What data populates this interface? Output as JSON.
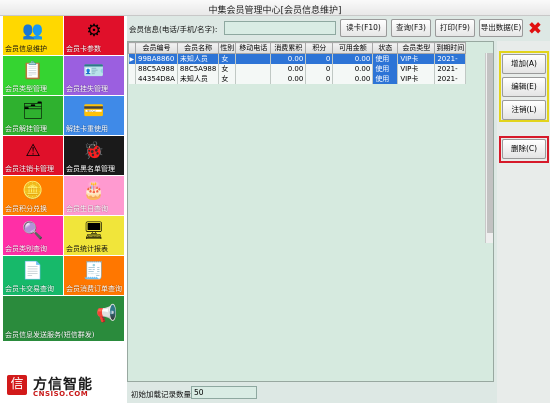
{
  "window": {
    "title": "中集会员管理中心[会员信息维护]"
  },
  "tiles": [
    {
      "label": "会员信息维护",
      "color": "#ffd800",
      "icon": "customer-card-icon",
      "glyph": "👥"
    },
    {
      "label": "会员卡参数",
      "color": "#e0102a",
      "icon": "card-settings-icon",
      "glyph": "⚙"
    },
    {
      "label": "会员类型管理",
      "color": "#35d431",
      "icon": "member-type-icon",
      "glyph": "📋"
    },
    {
      "label": "会员挂失管理",
      "color": "#9b5fe0",
      "icon": "report-loss-icon",
      "glyph": "🪪"
    },
    {
      "label": "会员解挂管理",
      "color": "#2fb12f",
      "icon": "unfreeze-icon",
      "glyph": "🗂"
    },
    {
      "label": "解挂卡重使用",
      "color": "#3f8ae8",
      "icon": "card-reuse-icon",
      "glyph": "💳"
    },
    {
      "label": "会员注销卡管理",
      "color": "#e0102a",
      "icon": "cancel-card-icon",
      "glyph": "⚠"
    },
    {
      "label": "会员黑名单管理",
      "color": "#1a1a1a",
      "icon": "blacklist-bug-icon",
      "glyph": "🐞"
    },
    {
      "label": "会员积分兑换",
      "color": "#ff7f00",
      "icon": "points-exchange-icon",
      "glyph": "🪙"
    },
    {
      "label": "会员生日查询",
      "color": "#ff9ad0",
      "icon": "birthday-icon",
      "glyph": "🎂"
    },
    {
      "label": "会员类别查询",
      "color": "#ff2fa6",
      "icon": "category-search-icon",
      "glyph": "🔍"
    },
    {
      "label": "会员统计报表",
      "color": "#f1e53a",
      "icon": "statistics-report-icon",
      "glyph": "🖥"
    },
    {
      "label": "会员卡交易查询",
      "color": "#17b96a",
      "icon": "card-transaction-icon",
      "glyph": "📄"
    },
    {
      "label": "会员消费订单查询",
      "color": "#ff7700",
      "icon": "consume-order-icon",
      "glyph": "🧾"
    },
    {
      "label": "会员信息发送服务(短信群发)",
      "color": "#2a8b3c",
      "icon": "sms-send-icon",
      "glyph": "📢"
    }
  ],
  "logo": {
    "brand": "方信智能",
    "site": "CNSISO.COM",
    "mark": "信"
  },
  "search": {
    "label": "会员信息(电话/手机/名字):",
    "value": "",
    "read_card_button": "读卡(F10)",
    "query_button": "查询(F3)",
    "print_button": "打印(F9)",
    "export_button": "导出数据(E)"
  },
  "table": {
    "columns": [
      "会员编号",
      "会员名称",
      "性别",
      "移动电话",
      "消费累积",
      "积分",
      "可用金额",
      "状态",
      "会员类型",
      "到期时间"
    ],
    "rows": [
      [
        "99BA8860",
        "未知人员",
        "女",
        "",
        "0.00",
        "0",
        "0.00",
        "使用",
        "VIP卡",
        "2021-"
      ],
      [
        "88C5A988",
        "88C5A988",
        "女",
        "",
        "0.00",
        "0",
        "0.00",
        "使用",
        "VIP卡",
        "2021-"
      ],
      [
        "44354D8A",
        "未知人员",
        "女",
        "",
        "0.00",
        "0",
        "0.00",
        "使用",
        "VIP卡",
        "2021-"
      ]
    ],
    "selected_row": 0
  },
  "bottom": {
    "label": "初始加载记录数量",
    "value": "50"
  },
  "side": {
    "add_button": "增加(A)",
    "edit_button": "编辑(E)",
    "cancel_button": "注销(L)",
    "delete_button": "删除(C)"
  }
}
